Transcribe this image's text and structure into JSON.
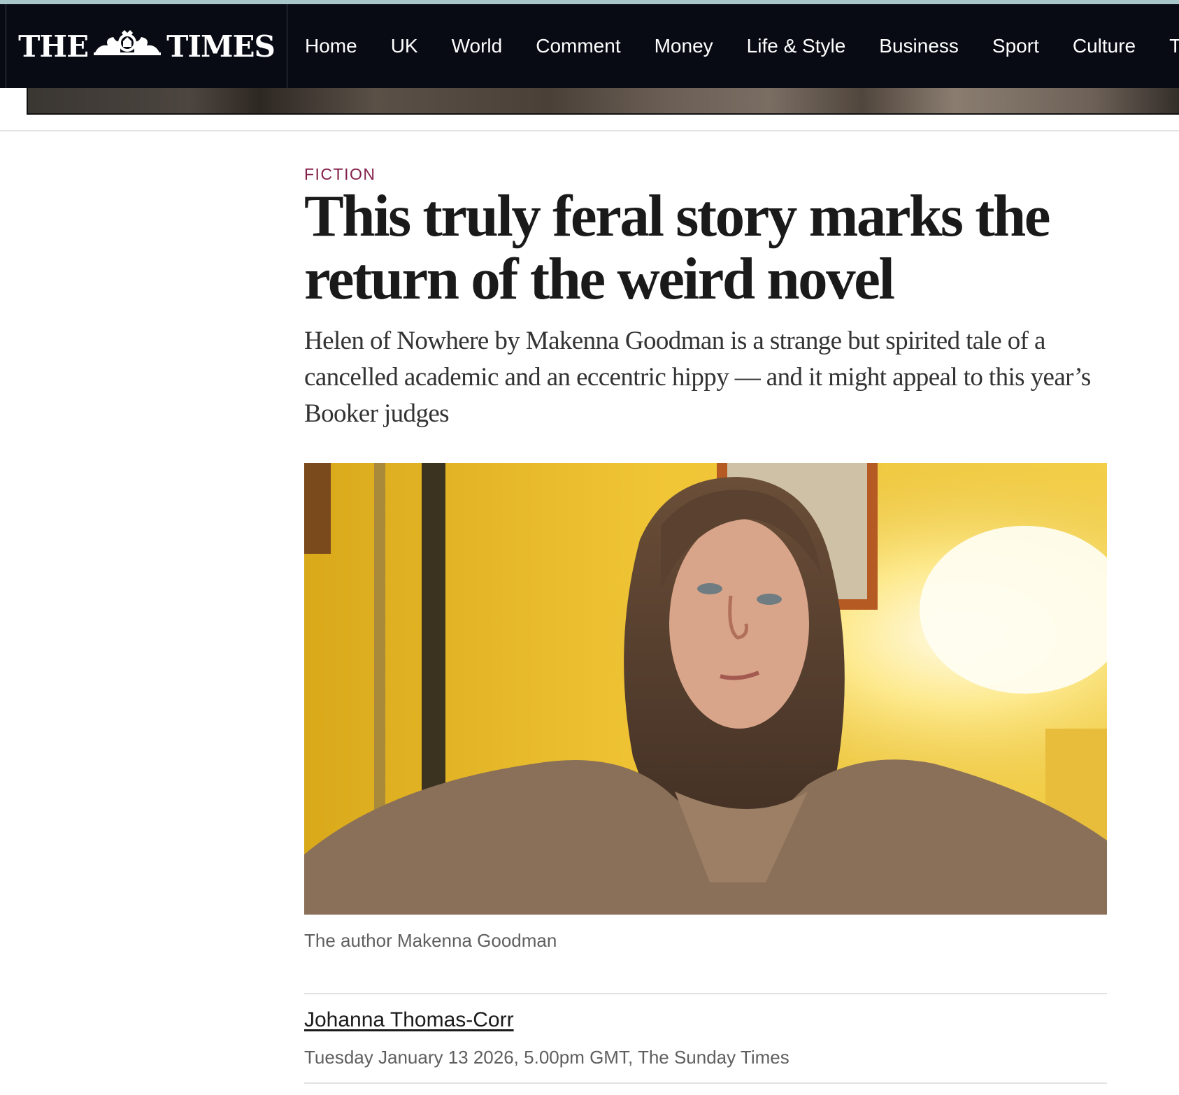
{
  "masthead": {
    "logo_left": "THE",
    "logo_right": "TIMES",
    "crest_icon": "royal-crest-icon"
  },
  "nav": {
    "items": [
      "Home",
      "UK",
      "World",
      "Comment",
      "Money",
      "Life & Style",
      "Business",
      "Sport",
      "Culture",
      "T"
    ]
  },
  "article": {
    "category": "FICTION",
    "headline": "This truly feral story marks the return of the weird novel",
    "standfirst": "Helen of Nowhere by Makenna Goodman is a strange but spirited tale of a cancelled academic and an eccentric hippy — and it might appeal to this year’s Booker judges",
    "image_caption": "The author Makenna Goodman",
    "author": "Johanna Thomas-Corr",
    "dateline": "Tuesday January 13 2026, 5.00pm GMT, The Sunday Times"
  },
  "colors": {
    "nav_background": "#080a14",
    "category_accent": "#84204a",
    "text_primary": "#1a1a1a",
    "text_secondary": "#5f5f5f"
  }
}
